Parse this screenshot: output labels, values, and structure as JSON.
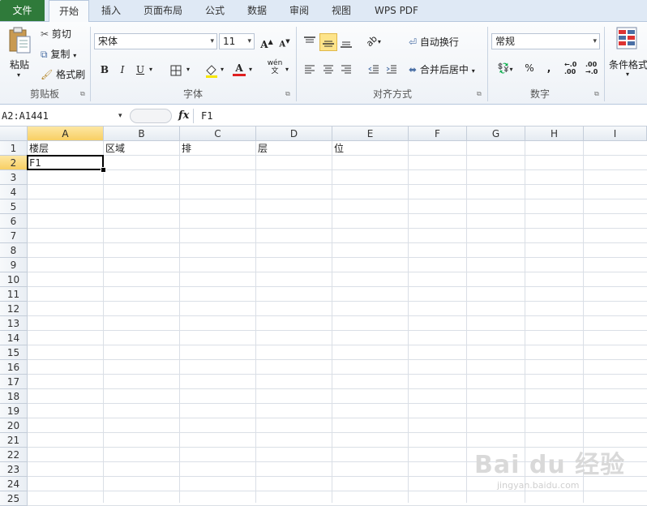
{
  "tabs": [
    "文件",
    "开始",
    "插入",
    "页面布局",
    "公式",
    "数据",
    "审阅",
    "视图",
    "WPS PDF"
  ],
  "ribbon": {
    "clipboard": {
      "paste": "粘贴",
      "cut": "剪切",
      "copy": "复制",
      "format_painter": "格式刷",
      "group": "剪贴板"
    },
    "font": {
      "name": "宋体",
      "size": "11",
      "bold": "B",
      "italic": "I",
      "underline": "U",
      "grow": "A",
      "shrink": "A",
      "font_color_glyph": "A",
      "phonetic": "wén\n文",
      "group": "字体"
    },
    "alignment": {
      "wrap": "自动换行",
      "merge": "合并后居中",
      "group": "对齐方式"
    },
    "number": {
      "format": "常规",
      "percent": "%",
      "comma": ",",
      "inc_decimal": "←.0\n.00",
      "dec_decimal": ".00\n→.0",
      "group": "数字"
    },
    "styles": {
      "conditional": "条件格式"
    }
  },
  "formula_bar": {
    "name_box": "A2:A1441",
    "fx": "fx",
    "content": "F1"
  },
  "columns": [
    "A",
    "B",
    "C",
    "D",
    "E",
    "F",
    "G",
    "H",
    "I"
  ],
  "rows": [
    "1",
    "2",
    "3",
    "4",
    "5",
    "6",
    "7",
    "8",
    "9",
    "10",
    "11",
    "12",
    "13",
    "14",
    "15",
    "16",
    "17",
    "18",
    "19",
    "20",
    "21",
    "22",
    "23",
    "24",
    "25"
  ],
  "cells": {
    "A1": "楼层",
    "B1": "区域",
    "C1": "排",
    "D1": "层",
    "E1": "位",
    "A2": "F1"
  },
  "watermark": {
    "brand": "Bai du 经验",
    "url": "jingyan.baidu.com"
  },
  "colors": {
    "file_tab": "#2f7a3a",
    "selected_header": "#f8cf63",
    "accent_red": "#e02020"
  }
}
